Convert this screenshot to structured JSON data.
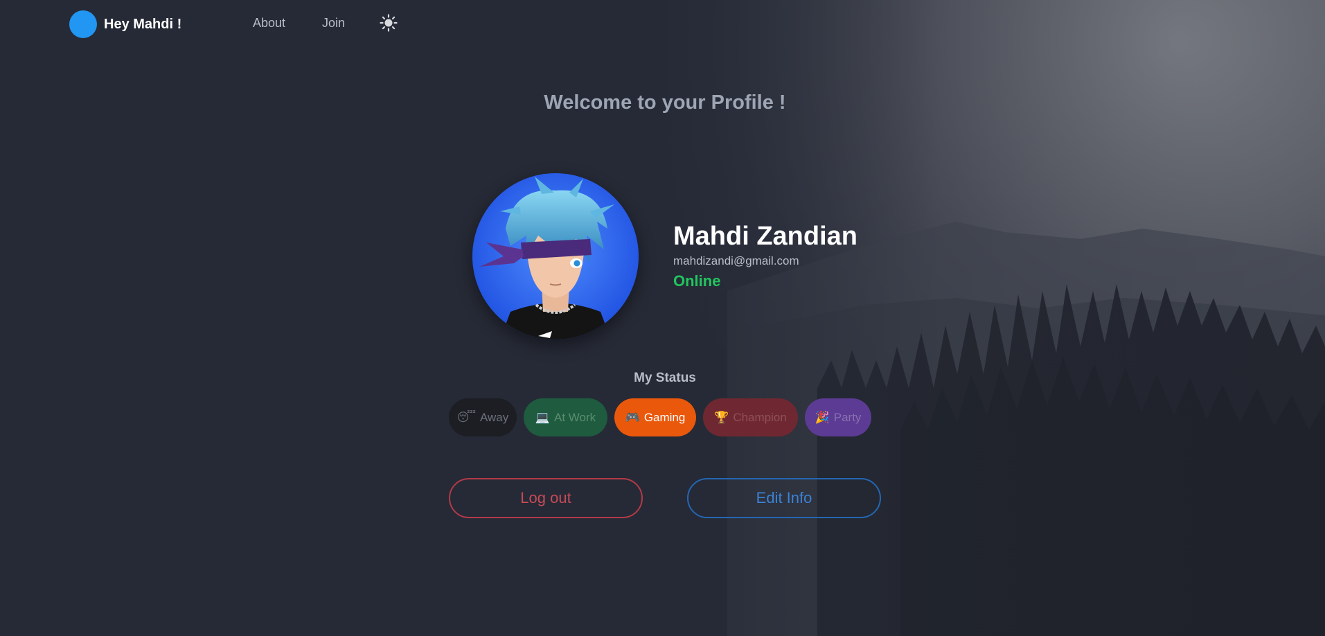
{
  "navbar": {
    "brand_text": "Hey Mahdi !",
    "links": [
      "About",
      "Join"
    ],
    "theme_toggle_icon": "sun-icon"
  },
  "welcome_heading": "Welcome to your Profile !",
  "profile": {
    "name": "Mahdi Zandian",
    "email": "mahdizandi@gmail.com",
    "presence": "Online",
    "avatar_icon": "anime-character-avatar"
  },
  "status": {
    "heading": "My Status",
    "selected": "Gaming",
    "options": [
      {
        "label": "Away",
        "icon": "😴",
        "icon_name": "sleepy-face-icon"
      },
      {
        "label": "At Work",
        "icon": "💻",
        "icon_name": "laptop-icon"
      },
      {
        "label": "Gaming",
        "icon": "🎮",
        "icon_name": "game-controller-icon"
      },
      {
        "label": "Champion",
        "icon": "🏆",
        "icon_name": "trophy-icon"
      },
      {
        "label": "Party",
        "icon": "🎉",
        "icon_name": "party-popper-icon"
      }
    ]
  },
  "actions": {
    "logout_label": "Log out",
    "edit_label": "Edit Info"
  },
  "colors": {
    "background": "#262a36",
    "brand_avatar": "#2196f3",
    "presence_online": "#22c55e",
    "gaming_selected": "#ea580c",
    "logout_border": "#b33a48",
    "edit_border": "#2367b4"
  }
}
